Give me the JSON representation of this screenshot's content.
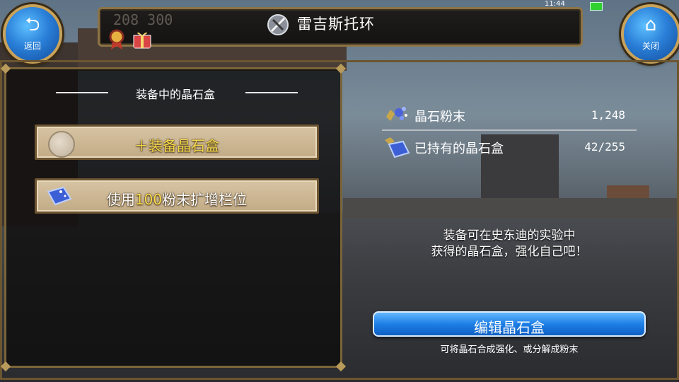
{
  "header": {
    "title": "雷吉斯托环",
    "back_label": "返回",
    "close_label": "关闭",
    "faded_numbers": "208  300",
    "clock": "11:44"
  },
  "left_panel": {
    "section_title": "装备中的晶石盒",
    "equip_button": "＋装备晶石盒",
    "expand_button": {
      "prefix": "使用",
      "amount": "100",
      "suffix": "粉末扩增栏位"
    }
  },
  "info": {
    "rows": [
      {
        "name": "晶石粉末",
        "value": "1,248",
        "icon": "crystal-powder-icon"
      },
      {
        "name": "已持有的晶石盒",
        "value": "42/255",
        "icon": "crystal-box-icon"
      }
    ],
    "description_line1": "装备可在史东迪的实验中",
    "description_line2": "获得的晶石盒，强化自己吧！"
  },
  "actions": {
    "edit_button": "编辑晶石盒",
    "hint": "可将晶石合成强化、或分解成粉末"
  },
  "colors": {
    "accent_blue": "#1d7fe6",
    "highlight_yellow": "#f6d94a",
    "frame_gold": "#7a6438"
  }
}
